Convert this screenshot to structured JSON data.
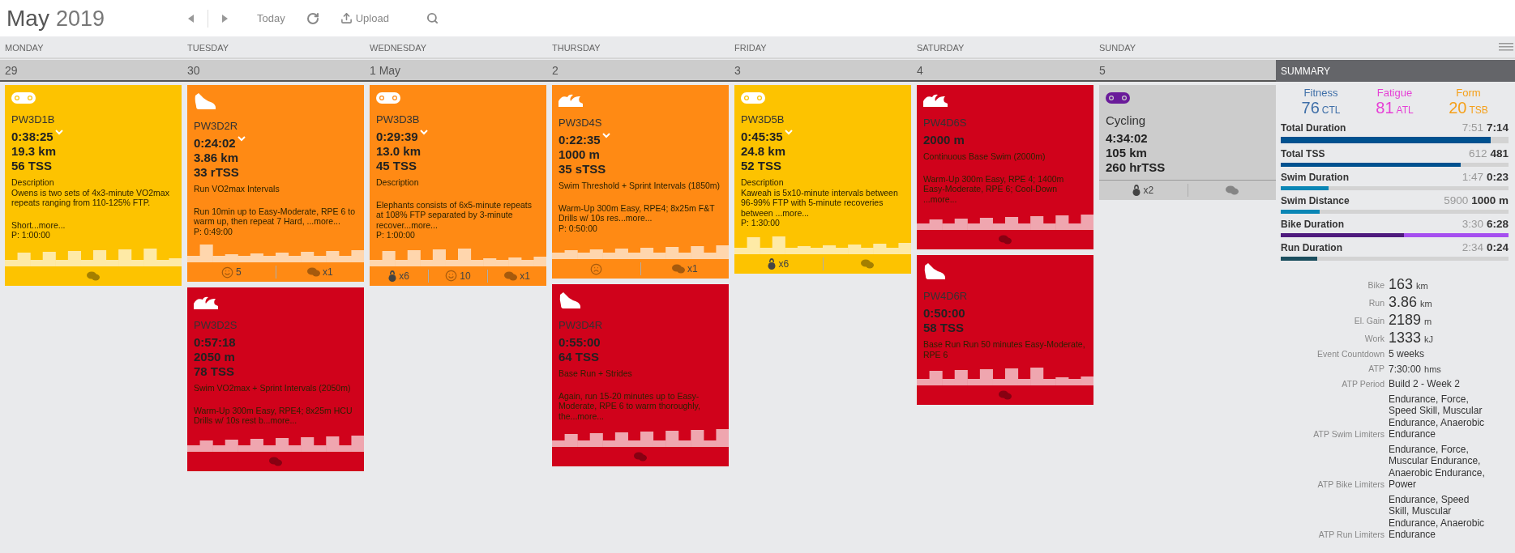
{
  "header": {
    "month": "May",
    "year": "2019",
    "today": "Today",
    "upload": "Upload"
  },
  "days": [
    {
      "name": "MONDAY",
      "date": "29",
      "workouts": [
        {
          "kind": "bike",
          "color": "#fdc300",
          "title": "PW3D1B",
          "metrics": [
            "0:38:25",
            "19.3 km",
            "56 TSS"
          ],
          "chevron": true,
          "blocks": [
            [
              "Description",
              "Owens is two sets of 4x3-minute VO2max repeats ranging from 110-125% FTP."
            ],
            [
              "Short...more...",
              "P: 1:00:00"
            ]
          ],
          "profile": true,
          "footer": [
            {
              "kind": "comments"
            }
          ]
        }
      ]
    },
    {
      "name": "TUESDAY",
      "date": "30",
      "workouts": [
        {
          "kind": "run",
          "color": "#ff8a14",
          "title": "PW3D2R",
          "metrics": [
            "0:24:02",
            "3.86 km",
            "33 rTSS"
          ],
          "chevron": true,
          "blocks": [
            [
              "Run VO2max Intervals"
            ],
            [
              "Run 10min up to Easy-Moderate, RPE 6 to warm up, then repeat 7 Hard, ...more...",
              "P: 0:49:00"
            ]
          ],
          "profile": true,
          "footer": [
            {
              "kind": "smile",
              "count": "5"
            },
            {
              "kind": "comments",
              "count": "x1"
            }
          ]
        },
        {
          "kind": "swim",
          "color": "#d0021b",
          "title": "PW3D2S",
          "metrics": [
            "0:57:18",
            "2050 m",
            "78 TSS"
          ],
          "chevron": false,
          "blocks": [
            [
              "Swim VO2max + Sprint Intervals (2050m)"
            ],
            [
              "Warm-Up 300m Easy, RPE4; 8x25m HCU Drills w/ 10s rest b...more..."
            ]
          ],
          "profile": true,
          "footer": [
            {
              "kind": "comments"
            }
          ]
        }
      ]
    },
    {
      "name": "WEDNESDAY",
      "date": "1 May",
      "workouts": [
        {
          "kind": "bike",
          "color": "#ff8a14",
          "title": "PW3D3B",
          "metrics": [
            "0:29:39",
            "13.0 km",
            "45 TSS"
          ],
          "chevron": true,
          "blocks": [
            [
              "Description"
            ],
            [
              "Elephants consists of 6x5-minute repeats at 108% FTP separated by 3-minute recover...more...",
              "P: 1:00:00"
            ]
          ],
          "profile": true,
          "footer": [
            {
              "kind": "equipment",
              "count": "x6"
            },
            {
              "kind": "smile",
              "count": "10"
            },
            {
              "kind": "comments",
              "count": "x1"
            }
          ]
        }
      ]
    },
    {
      "name": "THURSDAY",
      "date": "2",
      "workouts": [
        {
          "kind": "swim",
          "color": "#ff8a14",
          "title": "PW3D4S",
          "metrics": [
            "0:22:35",
            "1000 m",
            "35 sTSS"
          ],
          "chevron": true,
          "blocks": [
            [
              "Swim Threshold + Sprint Intervals (1850m)"
            ],
            [
              "Warm-Up 300m Easy, RPE4; 8x25m F&T Drills w/ 10s res...more...",
              "P: 0:50:00"
            ]
          ],
          "profile": true,
          "footer": [
            {
              "kind": "frown"
            },
            {
              "kind": "comments",
              "count": "x1"
            }
          ]
        },
        {
          "kind": "run",
          "color": "#d0021b",
          "title": "PW3D4R",
          "metrics": [
            "0:55:00",
            "64 TSS"
          ],
          "chevron": false,
          "blocks": [
            [
              "Base Run + Strides"
            ],
            [
              "Again, run 15-20 minutes up to Easy-Moderate, RPE 6 to warm thoroughly, the...more..."
            ]
          ],
          "profile": true,
          "footer": [
            {
              "kind": "comments"
            }
          ]
        }
      ]
    },
    {
      "name": "FRIDAY",
      "date": "3",
      "workouts": [
        {
          "kind": "bike",
          "color": "#fdc300",
          "title": "PW3D5B",
          "metrics": [
            "0:45:35",
            "24.8 km",
            "52 TSS"
          ],
          "chevron": true,
          "blocks": [
            [
              "Description",
              "Kaweah is 5x10-minute intervals between 96-99% FTP with 5-minute recoveries between ...more...",
              "P: 1:30:00"
            ]
          ],
          "profile": true,
          "footer": [
            {
              "kind": "equipment",
              "count": "x6"
            },
            {
              "kind": "comments"
            }
          ]
        }
      ]
    },
    {
      "name": "SATURDAY",
      "date": "4",
      "workouts": [
        {
          "kind": "swim",
          "color": "#d0021b",
          "title": "PW4D6S",
          "metrics": [
            "2000 m"
          ],
          "chevron": false,
          "blocks": [
            [
              "Continuous Base Swim (2000m)"
            ],
            [
              "Warm-Up 300m Easy, RPE 4; 1400m Easy-Moderate, RPE 6; Cool-Down ...more..."
            ]
          ],
          "profile": true,
          "footer": [
            {
              "kind": "comments"
            }
          ]
        },
        {
          "kind": "run",
          "color": "#d0021b",
          "title": "PW4D6R",
          "metrics": [
            "0:50:00",
            "58 TSS"
          ],
          "chevron": false,
          "blocks": [
            [
              "Base Run Run 50 minutes Easy-Moderate, RPE 6"
            ]
          ],
          "profile": true,
          "footer": [
            {
              "kind": "comments"
            }
          ]
        }
      ]
    },
    {
      "name": "SUNDAY",
      "date": "5",
      "workouts": [
        {
          "kind": "bike",
          "color": "#cccccc",
          "unplanned": true,
          "title": "Cycling",
          "metrics": [
            "4:34:02",
            "105 km",
            "260 hrTSS"
          ],
          "chevron": false,
          "profile": false,
          "footer": [
            {
              "kind": "equipment",
              "count": "x2"
            },
            {
              "kind": "comments"
            }
          ]
        }
      ]
    }
  ],
  "summary": {
    "title": "SUMMARY",
    "fitness": [
      {
        "label": "Fitness",
        "value": "76",
        "unit": "CTL",
        "color": "#3f6fa8"
      },
      {
        "label": "Fatigue",
        "value": "81",
        "unit": "ATL",
        "color": "#e63fd6"
      },
      {
        "label": "Form",
        "value": "20",
        "unit": "TSB",
        "color": "#f5a01a"
      }
    ],
    "bars": [
      {
        "label": "Total Duration",
        "planned": "7:51",
        "actual": "7:14",
        "level": 0.92,
        "color": "#00518f"
      },
      {
        "label": "Total TSS",
        "planned": "612",
        "actual": "481",
        "level": 0.79,
        "color": "#00518f"
      },
      {
        "label": "Swim Duration",
        "planned": "1:47",
        "actual": "0:23",
        "level": 0.21,
        "color": "#0a86b5"
      },
      {
        "label": "Swim Distance",
        "planned": "5900",
        "actual": "1000 m",
        "level": 0.17,
        "color": "#0a86b5"
      },
      {
        "label": "Bike Duration",
        "planned": "3:30",
        "actual": "6:28",
        "level": 0.54,
        "color": "#4e1a7d",
        "over": true
      },
      {
        "label": "Run Duration",
        "planned": "2:34",
        "actual": "0:24",
        "level": 0.16,
        "color": "#1b4e5e"
      }
    ],
    "details": [
      {
        "kind": "metric",
        "label": "Bike",
        "value": "163",
        "unit": "km"
      },
      {
        "kind": "metric",
        "label": "Run",
        "value": "3.86",
        "unit": "km"
      },
      {
        "kind": "metric",
        "label": "El. Gain",
        "value": "2189",
        "unit": "m"
      },
      {
        "kind": "metric",
        "label": "Work",
        "value": "1333",
        "unit": "kJ"
      },
      {
        "kind": "text",
        "label": "Event Countdown",
        "value": "5 weeks"
      },
      {
        "kind": "text",
        "label": "ATP",
        "value": "7:30:00",
        "unit": "hms"
      },
      {
        "kind": "text",
        "label": "ATP Period",
        "value": "Build 2 - Week 2"
      },
      {
        "kind": "text",
        "label": "ATP Swim Limiters",
        "value": "Endurance, Force, Speed Skill, Muscular Endurance, Anaerobic Endurance"
      },
      {
        "kind": "text",
        "label": "ATP Bike Limiters",
        "value": "Endurance, Force, Muscular Endurance, Anaerobic Endurance, Power"
      },
      {
        "kind": "text",
        "label": "ATP Run Limiters",
        "value": "Endurance, Speed Skill, Muscular Endurance, Anaerobic Endurance"
      }
    ]
  }
}
